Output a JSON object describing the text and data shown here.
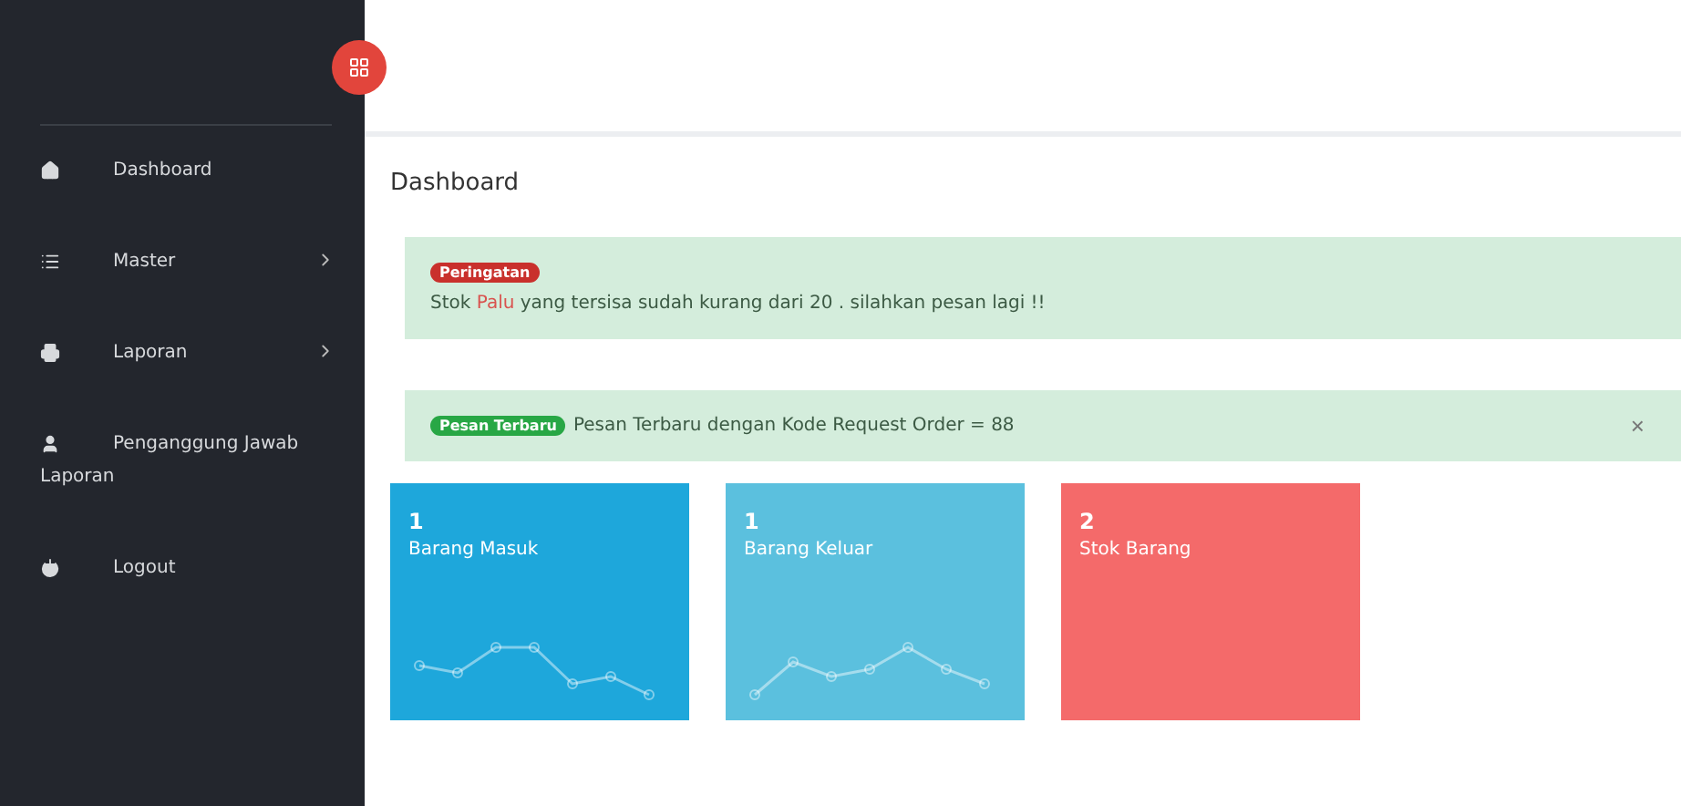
{
  "sidebar": {
    "items": [
      {
        "label": "Dashboard",
        "submenu": false
      },
      {
        "label": "Master",
        "submenu": true
      },
      {
        "label": "Laporan",
        "submenu": true
      },
      {
        "label": "Penganggung Jawab Laporan",
        "submenu": false
      },
      {
        "label": "Logout",
        "submenu": false
      }
    ]
  },
  "page_title": "Dashboard",
  "alerts": [
    {
      "kind": "warning",
      "badge": "Peringatan",
      "before": "Stok ",
      "highlight": "Palu",
      "after": " yang tersisa sudah kurang dari 20 . silahkan pesan lagi !!"
    },
    {
      "kind": "message",
      "badge": "Pesan Terbaru",
      "before": "Pesan Terbaru dengan Kode Request Order = 88",
      "close": "×"
    }
  ],
  "cards": [
    {
      "count": "1",
      "label": "Barang Masuk",
      "color": "#1ea7db",
      "kind": "sparkline"
    },
    {
      "count": "1",
      "label": "Barang Keluar",
      "color": "#5bc0de",
      "kind": "sparkline"
    },
    {
      "count": "2",
      "label": "Stok Barang",
      "color": "#f46a6a",
      "kind": "plain"
    }
  ]
}
